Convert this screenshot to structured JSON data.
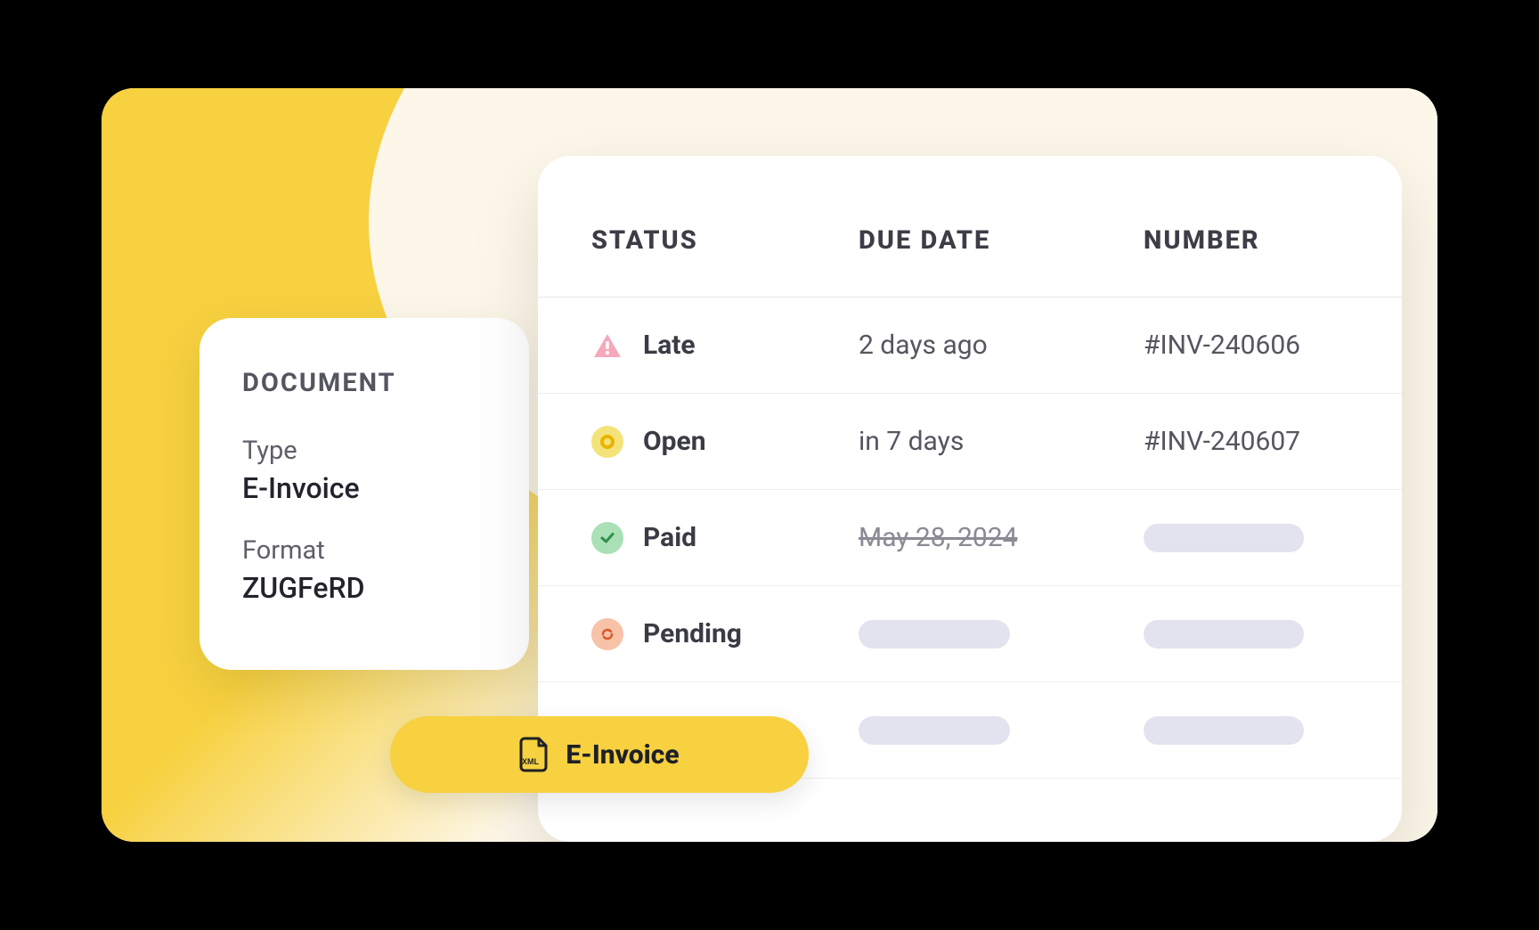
{
  "document": {
    "heading": "DOCUMENT",
    "type_label": "Type",
    "type_value": "E-Invoice",
    "format_label": "Format",
    "format_value": "ZUGFeRD"
  },
  "table": {
    "headers": {
      "status": "STATUS",
      "due": "DUE DATE",
      "number": "NUMBER"
    },
    "rows": [
      {
        "status": "Late",
        "icon": "alert",
        "due": "2 days ago",
        "number": "#INV-240606",
        "struck": false
      },
      {
        "status": "Open",
        "icon": "circle",
        "due": "in 7 days",
        "number": "#INV-240607",
        "struck": false
      },
      {
        "status": "Paid",
        "icon": "check",
        "due": "May 28, 2024",
        "number": "",
        "struck": true
      },
      {
        "status": "Pending",
        "icon": "refresh",
        "due": "",
        "number": "",
        "struck": false
      },
      {
        "status": "",
        "icon": "",
        "due": "",
        "number": "",
        "struck": false
      }
    ]
  },
  "button": {
    "label": "E-Invoice"
  },
  "colors": {
    "accent": "#f7d13f",
    "late": "#f06584",
    "open_bg": "#f4e37a",
    "open_ring": "#e9b400",
    "paid_bg": "#9fdcac",
    "paid_fg": "#2a8a44",
    "pending_bg": "#f5b89a",
    "pending_fg": "#d85a2a"
  }
}
